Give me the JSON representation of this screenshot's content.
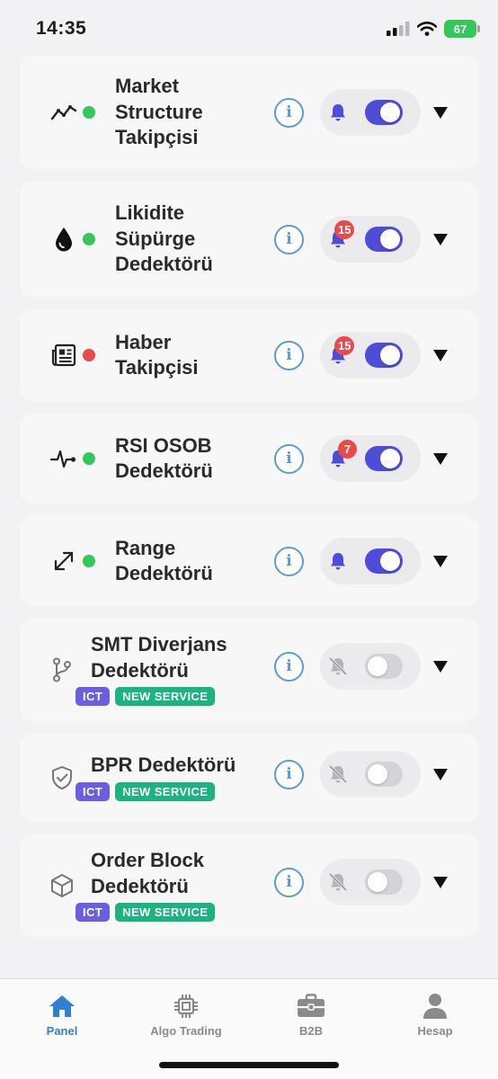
{
  "status_bar": {
    "time": "14:35",
    "battery": "67"
  },
  "accent": {
    "toggle_on": "#4d4dd8",
    "dot_active": "#34c759",
    "dot_error": "#e74b4b",
    "info": "#5b9bd5",
    "ict_tag": "#6a5fe0",
    "new_tag": "#1bb380",
    "tab_active": "#2f7fd6"
  },
  "services": [
    {
      "title_lines": [
        "Market",
        "Structure",
        "Takipçisi"
      ],
      "icon": "trend-line-icon",
      "dot": "green",
      "notifications": "on",
      "badge": "",
      "enabled": true,
      "tags": []
    },
    {
      "title_lines": [
        "Likidite",
        "Süpürge",
        "Dedektörü"
      ],
      "icon": "drop-icon",
      "dot": "green",
      "notifications": "on",
      "badge": "15",
      "enabled": true,
      "tags": []
    },
    {
      "title_lines": [
        "Haber",
        "Takipçisi"
      ],
      "icon": "newspaper-icon",
      "dot": "red",
      "notifications": "on",
      "badge": "15",
      "enabled": true,
      "tags": []
    },
    {
      "title_lines": [
        "RSI OSOB",
        "Dedektörü"
      ],
      "icon": "pulse-icon",
      "dot": "green",
      "notifications": "on",
      "badge": "7",
      "enabled": true,
      "tags": []
    },
    {
      "title_lines": [
        "Range",
        "Dedektörü"
      ],
      "icon": "expand-arrows-icon",
      "dot": "green",
      "notifications": "on",
      "badge": "",
      "enabled": true,
      "tags": []
    },
    {
      "title_lines": [
        "SMT Diverjans",
        "Dedektörü"
      ],
      "icon": "git-branch-icon",
      "dot": "",
      "notifications": "off",
      "badge": "",
      "enabled": false,
      "tags": [
        "ICT",
        "NEW SERVICE"
      ]
    },
    {
      "title_lines": [
        "BPR Dedektörü"
      ],
      "icon": "shield-check-icon",
      "dot": "",
      "notifications": "off",
      "badge": "",
      "enabled": false,
      "tags": [
        "ICT",
        "NEW SERVICE"
      ]
    },
    {
      "title_lines": [
        "Order Block",
        "Dedektörü"
      ],
      "icon": "cube-icon",
      "dot": "",
      "notifications": "off",
      "badge": "",
      "enabled": false,
      "tags": [
        "ICT",
        "NEW SERVICE"
      ]
    }
  ],
  "info_glyph": "i",
  "tab_bar": {
    "active": 0,
    "tabs": [
      {
        "label": "Panel",
        "icon": "home-icon"
      },
      {
        "label": "Algo Trading",
        "icon": "chip-icon"
      },
      {
        "label": "B2B",
        "icon": "briefcase-icon"
      },
      {
        "label": "Hesap",
        "icon": "person-icon"
      }
    ]
  }
}
